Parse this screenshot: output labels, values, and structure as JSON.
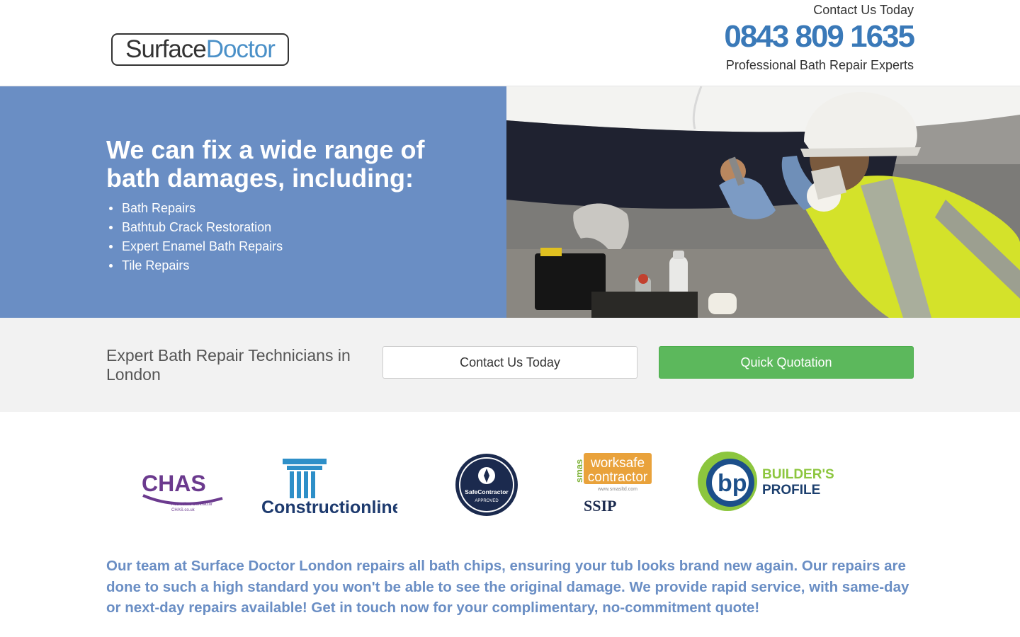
{
  "header": {
    "logo_part1": "Surface",
    "logo_part2": "Doctor",
    "contact_label": "Contact Us Today",
    "phone": "0843 809 1635",
    "tagline": "Professional Bath Repair Experts"
  },
  "hero": {
    "title": "We can fix a wide range of bath damages, including:",
    "services": [
      "Bath Repairs",
      "Bathtub Crack Restoration",
      "Expert Enamel Bath Repairs",
      "Tile Repairs"
    ],
    "background_color": "#6a8ec4"
  },
  "cta": {
    "text": "Expert Bath Repair Technicians in London",
    "contact_button": "Contact Us Today",
    "quote_button": "Quick Quotation",
    "quote_color": "#5cb85c"
  },
  "accreditations": {
    "chas": {
      "name": "CHAS",
      "sub1": "Accredited Contractor",
      "sub2": "CHAS.co.uk"
    },
    "constructionline": {
      "name": "Constructionline"
    },
    "safecontractor": {
      "name": "SafeContractor",
      "sub": "APPROVED"
    },
    "smas": {
      "tag": "smas",
      "line1": "worksafe",
      "line2": "contractor",
      "url": "www.smasltd.com",
      "ssip": "SSIP"
    },
    "builders_profile": {
      "line1": "BUILDER'S",
      "line2": "PROFILE"
    }
  },
  "intro": "Our team at Surface Doctor London repairs all bath chips, ensuring your tub looks brand new again. Our repairs are done to such a high standard you won't be able to see the original damage. We provide rapid service, with same-day or next-day repairs available! Get in touch now for your complimentary, no-commitment quote!"
}
